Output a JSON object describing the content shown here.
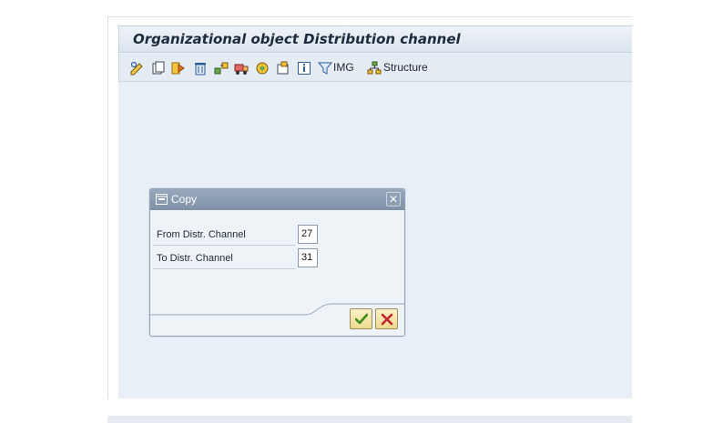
{
  "window": {
    "title": "Organizational object Distribution channel"
  },
  "toolbar": {
    "icons": [
      "display-change-icon",
      "new-entries-icon",
      "copy-as-icon",
      "delete-icon",
      "previous-entry-icon",
      "next-entry-icon",
      "transport-icon",
      "select-all-icon",
      "deselect-icon",
      "info-icon",
      "filter-icon",
      "structure-icon"
    ],
    "img_label": "IMG",
    "structure_label": "Structure"
  },
  "dialog": {
    "title": "Copy",
    "close_symbol": "✕",
    "rows": [
      {
        "label": "From Distr. Channel",
        "value": "27"
      },
      {
        "label": "To Distr. Channel",
        "value": "31"
      }
    ],
    "confirm_icon": "checkmark-icon",
    "cancel_icon": "cancel-x-icon"
  },
  "colors": {
    "background": "#e9eff6",
    "dialog_header": "#8a9cb2",
    "button_fill": "#f3e3a3",
    "confirm_green": "#3b8d1c",
    "cancel_red": "#c0262a"
  }
}
